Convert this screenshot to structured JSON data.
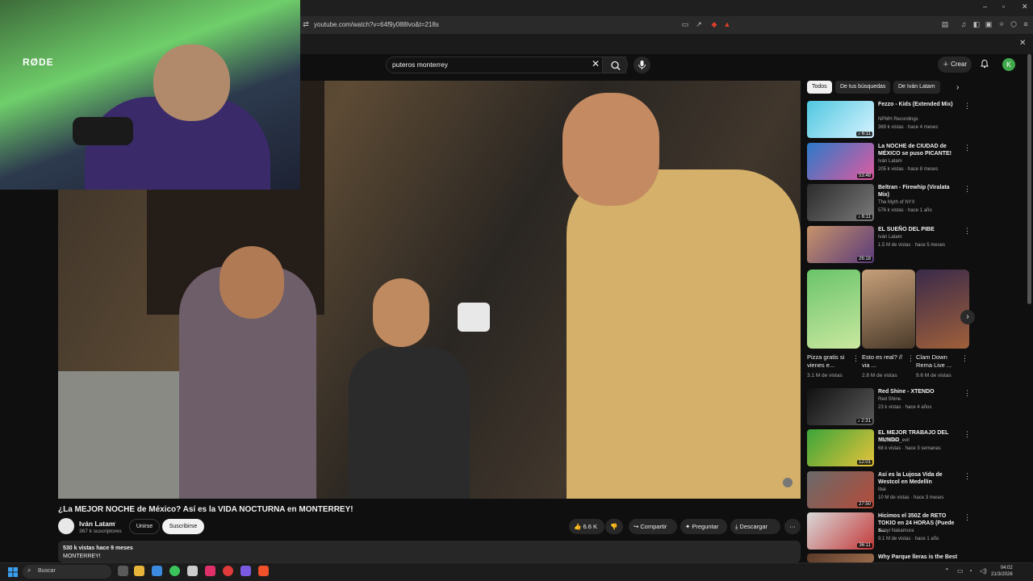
{
  "browser": {
    "url": "youtube.com/watch?v=64f9y088lvo&t=218s",
    "close_symbol": "✕"
  },
  "webcam": {
    "mic_brand": "RØDE"
  },
  "header": {
    "search_value": "puteros monterrey",
    "create_label": "Crear",
    "avatar_letter": "K"
  },
  "video": {
    "title": "¿La MEJOR NOCHE de México? Así es la VIDA NOCTURNA en MONTERREY!",
    "channel_name": "Iván Latam",
    "subscribers": "367 k suscriptores",
    "join_label": "Unirse",
    "subscribe_label": "Suscribirse",
    "likes": "6.6 K",
    "share_label": "Compartir",
    "ask_label": "Preguntar",
    "download_label": "Descargar",
    "views_and_age": "530 k vistas  hace 9 meses",
    "description": "MONTERREY!"
  },
  "chips": [
    {
      "label": "Todos"
    },
    {
      "label": "De tus búsquedas"
    },
    {
      "label": "De Iván Latam"
    }
  ],
  "recommendations": [
    {
      "title": "Fezzo - Kids (Extended Mix)",
      "channel": "NPMH Recordings",
      "meta": "369 k vistas · hace 4 meses",
      "duration": "♪ 6:11",
      "color1": "#4fc7e0",
      "color2": "#d7f3ff"
    },
    {
      "title": "La NOCHE de CIUDAD de MÉXICO se puso PICANTE!",
      "channel": "Iván Latam",
      "meta": "205 k vistas · hace 8 meses",
      "duration": "53:48",
      "color1": "#2b7ac9",
      "color2": "#e05aa0"
    },
    {
      "title": "Beltran - Firewhip (Viralata Mix)",
      "channel": "The Myth of NYX",
      "meta": "576 k vistas · hace 1 año",
      "duration": "♪ 6:11",
      "color1": "#2b2b2b",
      "color2": "#7a7a7a"
    },
    {
      "title": "EL SUEÑO DEL PIBE",
      "channel": "Iván Latam",
      "meta": "1.5 M de vistas · hace 5 meses",
      "duration": "26:18",
      "color1": "#c7936a",
      "color2": "#5a3b7a"
    },
    {
      "title": "Red Shine - XTENDO",
      "channel": "Red Shine.",
      "meta": "23 k vistas · hace 4 años",
      "duration": "♪ 2:31",
      "color1": "#111111",
      "color2": "#5a5a5a"
    },
    {
      "title": "EL MEJOR TRABAJO DEL MUNDO",
      "channel": "Kamikaze_evil",
      "meta": "68 k vistas · hace 3 semanas",
      "duration": "12:01",
      "color1": "#3aa53a",
      "color2": "#e7c23a"
    },
    {
      "title": "Así es la Lujosa Vida de Westcol en Medellín",
      "channel": "Ibai",
      "meta": "10 M de vistas · hace 3 meses",
      "duration": "27:50",
      "color1": "#6a6a6a",
      "color2": "#b54b3a"
    },
    {
      "title": "Hicimos el 350Z de RETO TOKIO en 24 HORAS (Puede s...",
      "channel": "Kenyi Nakamura",
      "meta": "9.1 M de vistas · hace 1 año",
      "duration": "36:11",
      "color1": "#d8d8d8",
      "color2": "#c43a3a"
    },
    {
      "title": "Why Parque lleras is the Best",
      "channel": "",
      "meta": "",
      "duration": "",
      "color1": "#5a3a2a",
      "color2": "#9a6a4a"
    }
  ],
  "shorts": [
    {
      "title": "Pizza gratis si vienes e...",
      "views": "3.1 M de vistas",
      "color1": "#6ac46a",
      "color2": "#c9e8a0"
    },
    {
      "title": "Esto es real? // via ...",
      "views": "2.8 M de vistas",
      "color1": "#c7a07a",
      "color2": "#4a3a2a"
    },
    {
      "title": "Clam Down Rema Live ...",
      "views": "9.6 M de vistas",
      "color1": "#3a2a4a",
      "color2": "#a0603a"
    }
  ],
  "taskbar": {
    "search_label": "Buscar",
    "time": "04:02",
    "date": "21/3/2026"
  }
}
